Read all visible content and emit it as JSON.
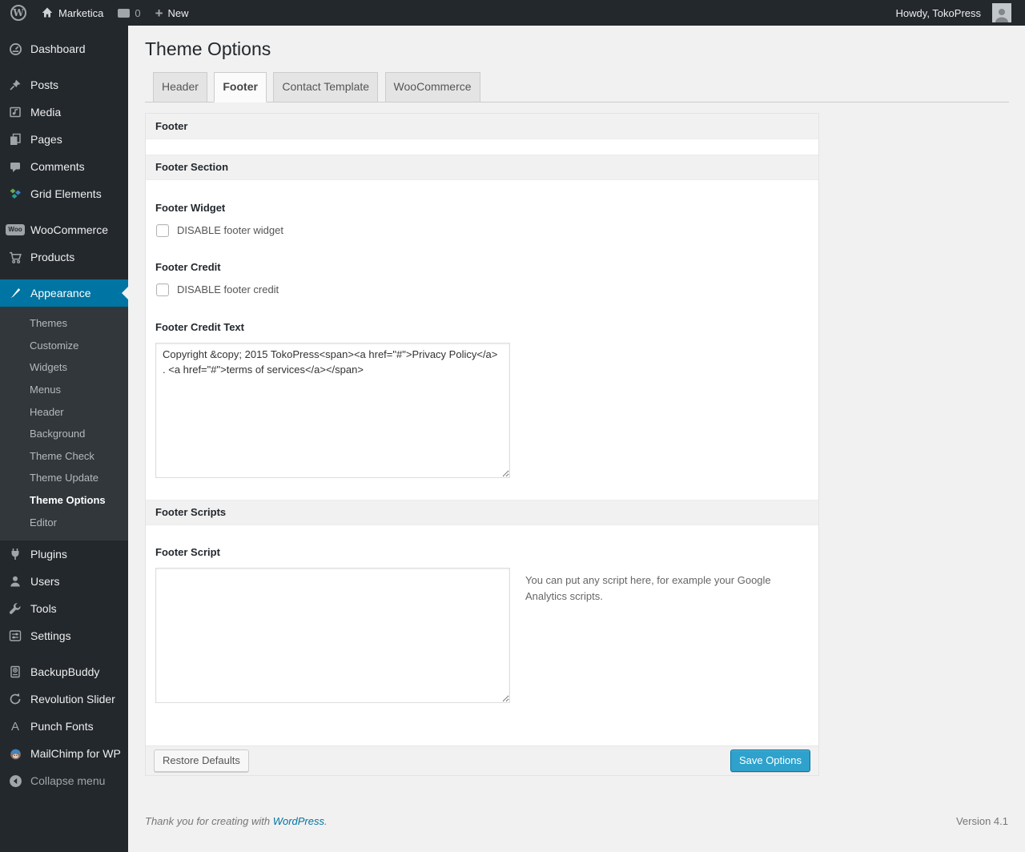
{
  "colors": {
    "accent": "#0074a2",
    "button_primary": "#2ea2cc",
    "sidebar_bg": "#23282d",
    "page_bg": "#f1f1f1"
  },
  "admin_bar": {
    "wp_logo_glyph": "W",
    "site_name": "Marketica",
    "comment_count": "0",
    "new_label": "New",
    "howdy": "Howdy, TokoPress"
  },
  "sidebar": {
    "items": [
      {
        "label": "Dashboard"
      },
      {
        "label": "Posts"
      },
      {
        "label": "Media"
      },
      {
        "label": "Pages"
      },
      {
        "label": "Comments"
      },
      {
        "label": "Grid Elements"
      },
      {
        "label": "WooCommerce"
      },
      {
        "label": "Products"
      },
      {
        "label": "Appearance"
      },
      {
        "label": "Plugins"
      },
      {
        "label": "Users"
      },
      {
        "label": "Tools"
      },
      {
        "label": "Settings"
      },
      {
        "label": "BackupBuddy"
      },
      {
        "label": "Revolution Slider"
      },
      {
        "label": "Punch Fonts"
      },
      {
        "label": "MailChimp for WP"
      },
      {
        "label": "Collapse menu"
      }
    ],
    "woo_icon_text": "Woo",
    "punch_icon_text": "A",
    "appearance_submenu": [
      "Themes",
      "Customize",
      "Widgets",
      "Menus",
      "Header",
      "Background",
      "Theme Check",
      "Theme Update",
      "Theme Options",
      "Editor"
    ]
  },
  "page": {
    "title": "Theme Options",
    "tabs": [
      {
        "label": "Header"
      },
      {
        "label": "Footer"
      },
      {
        "label": "Contact Template"
      },
      {
        "label": "WooCommerce"
      }
    ]
  },
  "panel": {
    "box_footer_title": "Footer",
    "section_title": "Footer Section",
    "footer_widget_label": "Footer Widget",
    "footer_widget_checkbox": "DISABLE footer widget",
    "footer_credit_label": "Footer Credit",
    "footer_credit_checkbox": "DISABLE footer credit",
    "footer_credit_text_label": "Footer Credit Text",
    "footer_credit_text_value": "Copyright &copy; 2015 TokoPress<span><a href=\"#\">Privacy Policy</a> . <a href=\"#\">terms of services</a></span>",
    "scripts_title": "Footer Scripts",
    "footer_script_label": "Footer Script",
    "footer_script_value": "",
    "footer_script_help": "You can put any script here, for example your Google Analytics scripts.",
    "restore_button": "Restore Defaults",
    "save_button": "Save Options"
  },
  "footer": {
    "thanks_prefix": "Thank you for creating with ",
    "thanks_link": "WordPress",
    "thanks_suffix": ".",
    "version": "Version 4.1"
  }
}
